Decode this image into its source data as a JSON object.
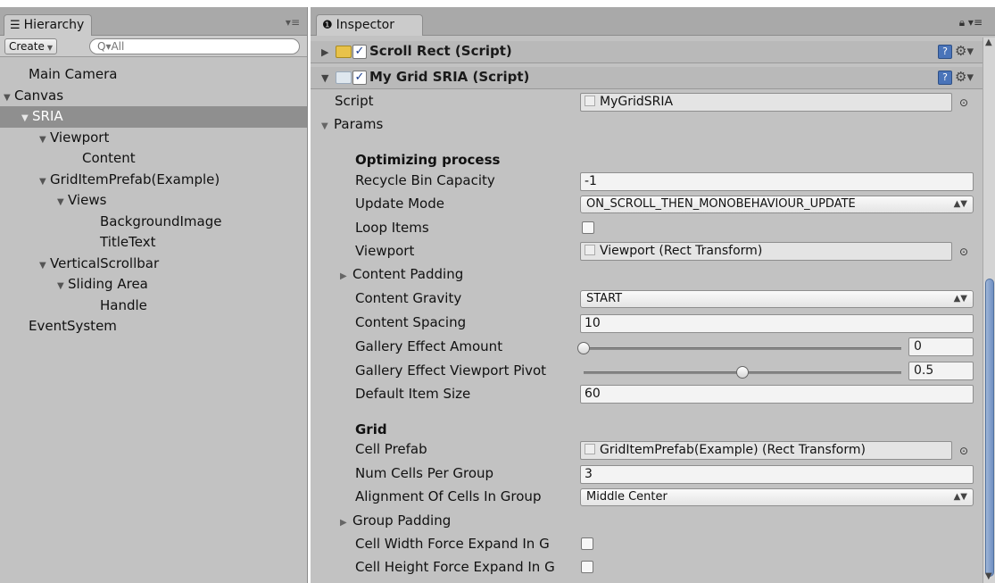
{
  "hierarchy": {
    "tab_label": "Hierarchy",
    "tab_icon": "list-icon",
    "create_label": "Create",
    "search_placeholder": "Q▾All",
    "items": [
      {
        "label": "Main Camera",
        "depth": 0,
        "expanded": null,
        "selected": false
      },
      {
        "label": "Canvas",
        "depth": 0,
        "expanded": true,
        "selected": false
      },
      {
        "label": "SRIA",
        "depth": 1,
        "expanded": true,
        "selected": true
      },
      {
        "label": "Viewport",
        "depth": 2,
        "expanded": true,
        "selected": false
      },
      {
        "label": "Content",
        "depth": 3,
        "expanded": null,
        "selected": false
      },
      {
        "label": "GridItemPrefab(Example)",
        "depth": 2,
        "expanded": true,
        "selected": false
      },
      {
        "label": "Views",
        "depth": 3,
        "expanded": true,
        "selected": false
      },
      {
        "label": "BackgroundImage",
        "depth": 4,
        "expanded": null,
        "selected": false
      },
      {
        "label": "TitleText",
        "depth": 4,
        "expanded": null,
        "selected": false
      },
      {
        "label": "VerticalScrollbar",
        "depth": 2,
        "expanded": true,
        "selected": false
      },
      {
        "label": "Sliding Area",
        "depth": 3,
        "expanded": true,
        "selected": false
      },
      {
        "label": "Handle",
        "depth": 4,
        "expanded": null,
        "selected": false
      },
      {
        "label": "EventSystem",
        "depth": 0,
        "expanded": null,
        "selected": false
      }
    ]
  },
  "inspector": {
    "tab_label": "Inspector",
    "tab_icon": "info-icon",
    "components": [
      {
        "title": "Scroll Rect (Script)",
        "enabled": true,
        "expanded": false
      },
      {
        "title": "My Grid SRIA (Script)",
        "enabled": true,
        "expanded": true
      }
    ],
    "script_label": "Script",
    "script_value": "MyGridSRIA",
    "params_label": "Params",
    "optimizing_header": "Optimizing process",
    "recycle_label": "Recycle Bin Capacity",
    "recycle_value": "-1",
    "update_mode_label": "Update Mode",
    "update_mode_value": "ON_SCROLL_THEN_MONOBEHAVIOUR_UPDATE",
    "loop_label": "Loop Items",
    "loop_checked": false,
    "viewport_label": "Viewport",
    "viewport_value": "Viewport (Rect Transform)",
    "content_padding_label": "Content Padding",
    "content_gravity_label": "Content Gravity",
    "content_gravity_value": "START",
    "content_spacing_label": "Content Spacing",
    "content_spacing_value": "10",
    "gallery_amount_label": "Gallery Effect Amount",
    "gallery_amount_value": "0",
    "gallery_amount_fraction": 0,
    "gallery_pivot_label": "Gallery Effect Viewport Pivot",
    "gallery_pivot_value": "0.5",
    "gallery_pivot_fraction": 0.5,
    "default_size_label": "Default Item Size",
    "default_size_value": "60",
    "grid_header": "Grid",
    "cell_prefab_label": "Cell Prefab",
    "cell_prefab_value": "GridItemPrefab(Example) (Rect Transform)",
    "num_cells_label": "Num Cells Per Group",
    "num_cells_value": "3",
    "alignment_label": "Alignment Of Cells In Group",
    "alignment_value": "Middle Center",
    "group_padding_label": "Group Padding",
    "cell_width_label": "Cell Width Force Expand In G",
    "cell_width_checked": false,
    "cell_height_label": "Cell Height Force Expand In G",
    "cell_height_checked": false
  },
  "colors": {
    "panel_bg": "#c2c2c2",
    "selection_bg": "#8f8f8f",
    "scroll_thumb": "#6f8fc2",
    "help_icon": "#4a74b9"
  }
}
